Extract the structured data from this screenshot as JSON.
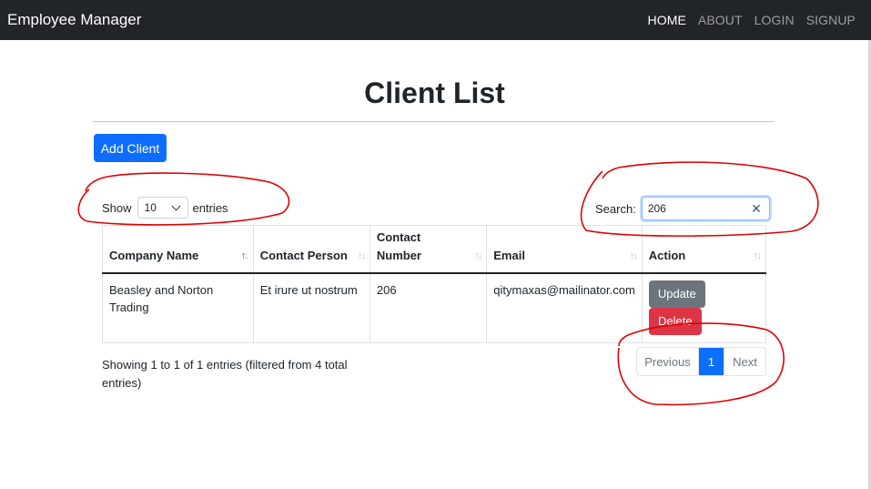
{
  "navbar": {
    "brand": "Employee Manager",
    "links": [
      "HOME",
      "ABOUT",
      "LOGIN",
      "SIGNUP"
    ],
    "active": "HOME"
  },
  "page": {
    "title": "Client List"
  },
  "toolbar": {
    "add_label": "Add Client"
  },
  "length_menu": {
    "show_label": "Show",
    "value": "10",
    "entries_label": "entries"
  },
  "search": {
    "label": "Search:",
    "value": "206",
    "clear_icon": "close-icon"
  },
  "table": {
    "headers": [
      "Company Name",
      "Contact Person",
      "Contact Number",
      "Email",
      "Action"
    ],
    "rows": [
      {
        "company": "Beasley and Norton Trading",
        "contact_person": "Et irure ut nostrum",
        "contact_number": "206",
        "email": "qitymaxas@mailinator.com",
        "actions": [
          "Update",
          "Delete"
        ]
      }
    ]
  },
  "info": "Showing 1 to 1 of 1 entries (filtered from 4 total entries)",
  "pagination": {
    "prev": "Previous",
    "current": "1",
    "next": "Next"
  },
  "colors": {
    "navbar": "#212529",
    "primary": "#0d6efd",
    "secondary": "#6c757d",
    "danger": "#dc3545",
    "annotation": "#e00000"
  }
}
